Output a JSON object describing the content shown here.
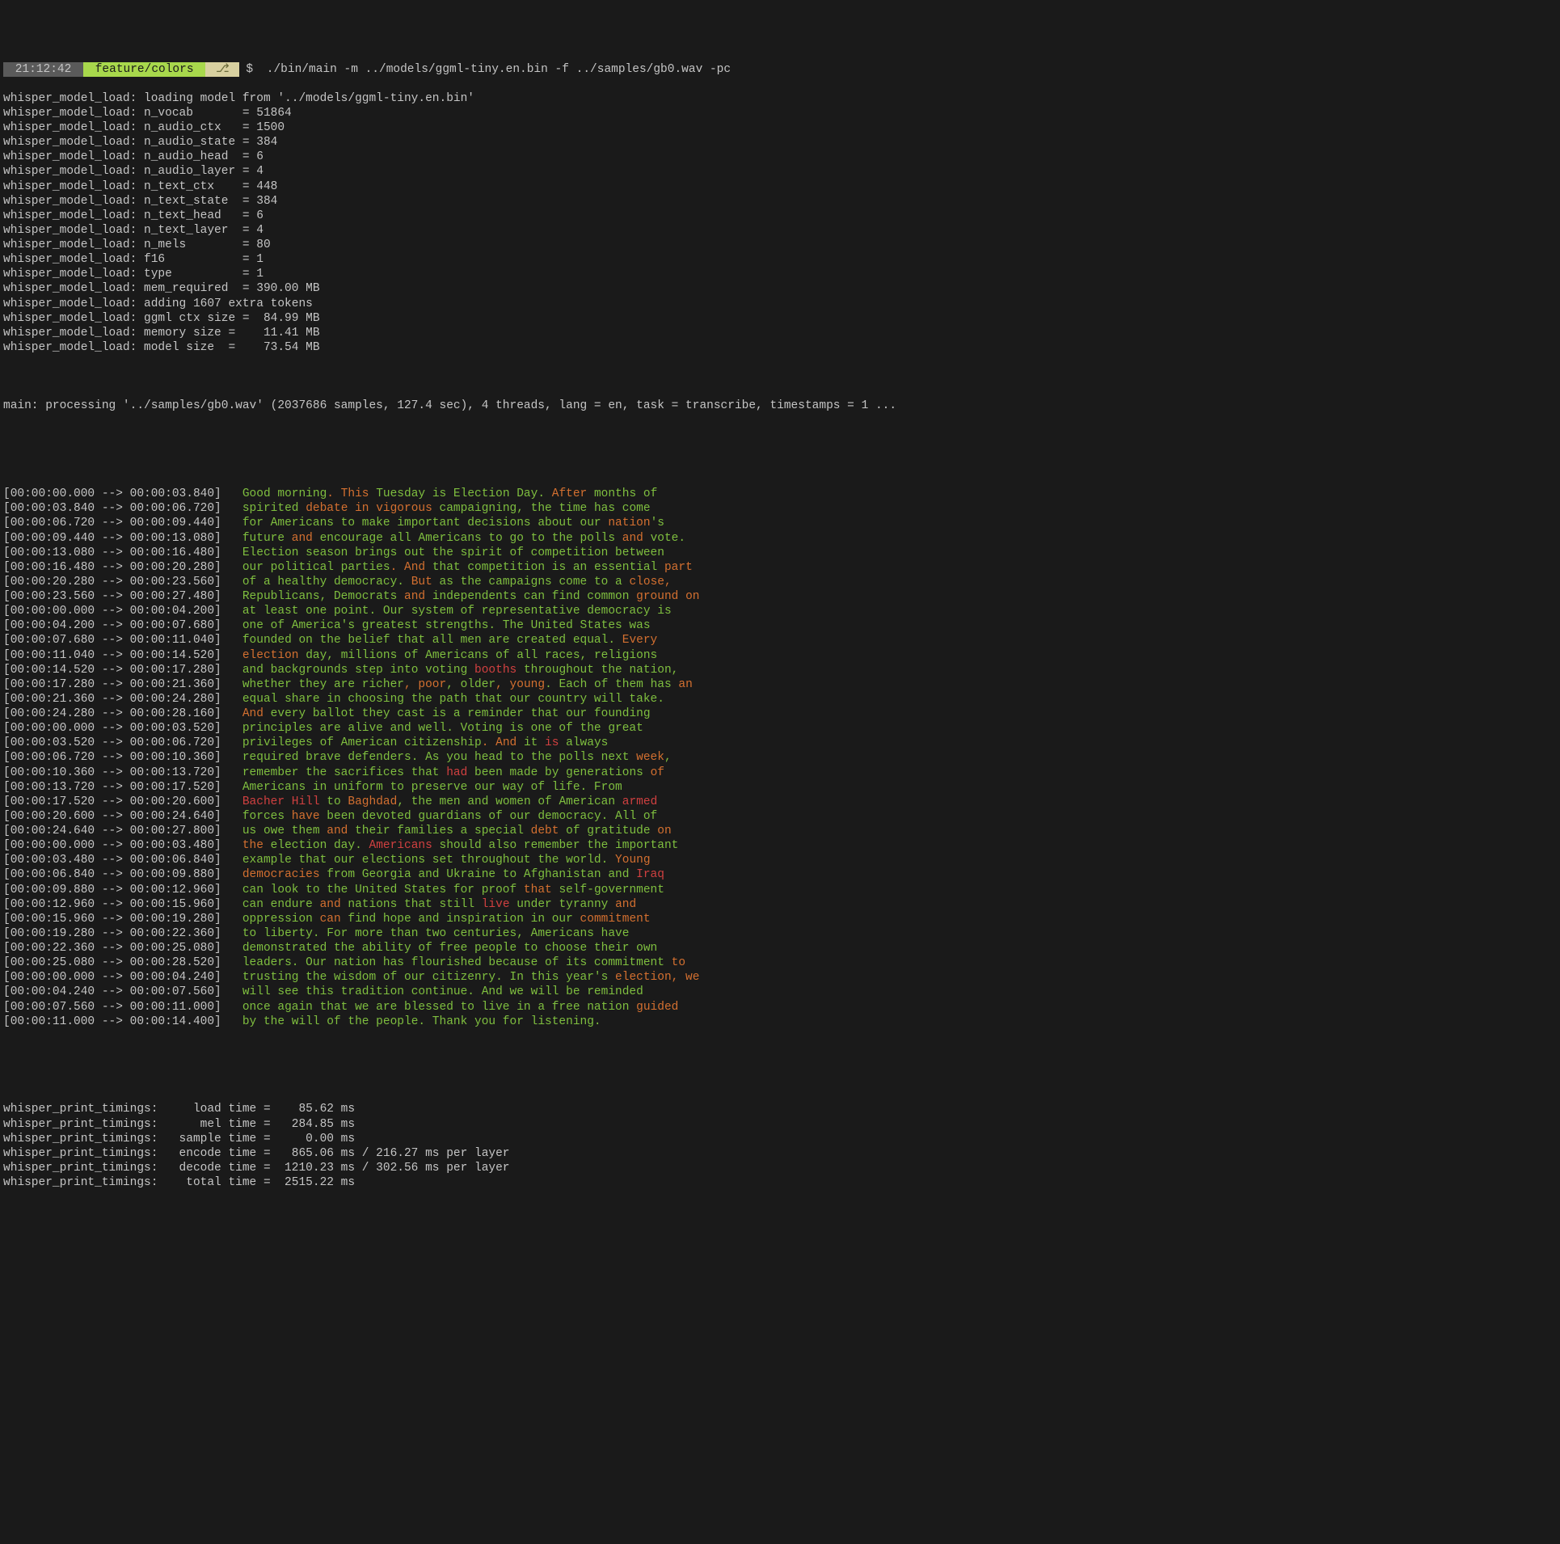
{
  "prompt": {
    "time": " 21:12:42 ",
    "branch": " feature/colors ",
    "branch_icon": " ⎇ ",
    "dollar": "$",
    "command": " ./bin/main -m ../models/ggml-tiny.en.bin -f ../samples/gb0.wav -pc"
  },
  "load_lines": [
    "whisper_model_load: loading model from '../models/ggml-tiny.en.bin'",
    "whisper_model_load: n_vocab       = 51864",
    "whisper_model_load: n_audio_ctx   = 1500",
    "whisper_model_load: n_audio_state = 384",
    "whisper_model_load: n_audio_head  = 6",
    "whisper_model_load: n_audio_layer = 4",
    "whisper_model_load: n_text_ctx    = 448",
    "whisper_model_load: n_text_state  = 384",
    "whisper_model_load: n_text_head   = 6",
    "whisper_model_load: n_text_layer  = 4",
    "whisper_model_load: n_mels        = 80",
    "whisper_model_load: f16           = 1",
    "whisper_model_load: type          = 1",
    "whisper_model_load: mem_required  = 390.00 MB",
    "whisper_model_load: adding 1607 extra tokens",
    "whisper_model_load: ggml ctx size =  84.99 MB",
    "whisper_model_load: memory size =    11.41 MB",
    "whisper_model_load: model size  =    73.54 MB"
  ],
  "main_line": "main: processing '../samples/gb0.wav' (2037686 samples, 127.4 sec), 4 threads, lang = en, task = transcribe, timestamps = 1 ...",
  "segments": [
    {
      "ts": "[00:00:00.000 --> 00:00:03.840]   ",
      "tok": [
        [
          "g",
          "Good morning"
        ],
        [
          "o",
          ". This "
        ],
        [
          "g",
          "Tuesday is Election Day. "
        ],
        [
          "o",
          "After "
        ],
        [
          "g",
          "months of"
        ]
      ]
    },
    {
      "ts": "[00:00:03.840 --> 00:00:06.720]   ",
      "tok": [
        [
          "g",
          "spirited "
        ],
        [
          "o",
          "debate in vigorous "
        ],
        [
          "g",
          "campaigning, the time has come"
        ]
      ]
    },
    {
      "ts": "[00:00:06.720 --> 00:00:09.440]   ",
      "tok": [
        [
          "g",
          "for Americans to make important decisions about our "
        ],
        [
          "o",
          "nation"
        ],
        [
          "g",
          "'s"
        ]
      ]
    },
    {
      "ts": "[00:00:09.440 --> 00:00:13.080]   ",
      "tok": [
        [
          "g",
          "future "
        ],
        [
          "o",
          "and "
        ],
        [
          "g",
          "encourage all Americans to go to the polls "
        ],
        [
          "o",
          "and "
        ],
        [
          "g",
          "vote."
        ]
      ]
    },
    {
      "ts": "[00:00:13.080 --> 00:00:16.480]   ",
      "tok": [
        [
          "g",
          "Election season brings out the spirit of competition between"
        ]
      ]
    },
    {
      "ts": "[00:00:16.480 --> 00:00:20.280]   ",
      "tok": [
        [
          "g",
          "our political parties"
        ],
        [
          "o",
          ". And "
        ],
        [
          "g",
          "that competition is an essential "
        ],
        [
          "o",
          "part"
        ]
      ]
    },
    {
      "ts": "[00:00:20.280 --> 00:00:23.560]   ",
      "tok": [
        [
          "g",
          "of a healthy democracy. "
        ],
        [
          "o",
          "But "
        ],
        [
          "g",
          "as the campaigns come to a "
        ],
        [
          "o",
          "close,"
        ]
      ]
    },
    {
      "ts": "[00:00:23.560 --> 00:00:27.480]   ",
      "tok": [
        [
          "g",
          "Republicans, Democrats "
        ],
        [
          "o",
          "and "
        ],
        [
          "g",
          "independents can find common "
        ],
        [
          "o",
          "ground on"
        ]
      ]
    },
    {
      "ts": "[00:00:00.000 --> 00:00:04.200]   ",
      "tok": [
        [
          "g",
          "at least one point. Our system of representative democracy is"
        ]
      ]
    },
    {
      "ts": "[00:00:04.200 --> 00:00:07.680]   ",
      "tok": [
        [
          "g",
          "one of America's greatest strengths. The United States was"
        ]
      ]
    },
    {
      "ts": "[00:00:07.680 --> 00:00:11.040]   ",
      "tok": [
        [
          "g",
          "founded on the belief that all men are created equal. "
        ],
        [
          "o",
          "Every"
        ]
      ]
    },
    {
      "ts": "[00:00:11.040 --> 00:00:14.520]   ",
      "tok": [
        [
          "o",
          "election "
        ],
        [
          "g",
          "day, millions of Americans of all races, religions"
        ]
      ]
    },
    {
      "ts": "[00:00:14.520 --> 00:00:17.280]   ",
      "tok": [
        [
          "g",
          "and backgrounds step into voting "
        ],
        [
          "r",
          "booths "
        ],
        [
          "g",
          "throughout the nation,"
        ]
      ]
    },
    {
      "ts": "[00:00:17.280 --> 00:00:21.360]   ",
      "tok": [
        [
          "g",
          "whether they are richer"
        ],
        [
          "o",
          ", poor"
        ],
        [
          "g",
          ", older"
        ],
        [
          "o",
          ", young"
        ],
        [
          "g",
          ". Each of them has "
        ],
        [
          "o",
          "an"
        ]
      ]
    },
    {
      "ts": "[00:00:21.360 --> 00:00:24.280]   ",
      "tok": [
        [
          "g",
          "equal share in choosing the path that our country will take."
        ]
      ]
    },
    {
      "ts": "[00:00:24.280 --> 00:00:28.160]   ",
      "tok": [
        [
          "o",
          "And "
        ],
        [
          "g",
          "every ballot they cast is a reminder that our founding"
        ]
      ]
    },
    {
      "ts": "[00:00:00.000 --> 00:00:03.520]   ",
      "tok": [
        [
          "g",
          "principles are alive and well. Voting is one of the great"
        ]
      ]
    },
    {
      "ts": "[00:00:03.520 --> 00:00:06.720]   ",
      "tok": [
        [
          "g",
          "privileges of American citizenship"
        ],
        [
          "o",
          ". And "
        ],
        [
          "g",
          "it "
        ],
        [
          "r",
          "is "
        ],
        [
          "g",
          "always"
        ]
      ]
    },
    {
      "ts": "[00:00:06.720 --> 00:00:10.360]   ",
      "tok": [
        [
          "g",
          "required brave defenders. As you head to the polls next "
        ],
        [
          "o",
          "week"
        ],
        [
          "g",
          ","
        ]
      ]
    },
    {
      "ts": "[00:00:10.360 --> 00:00:13.720]   ",
      "tok": [
        [
          "g",
          "remember the sacrifices that "
        ],
        [
          "r",
          "had "
        ],
        [
          "g",
          "been made by generations "
        ],
        [
          "o",
          "of"
        ]
      ]
    },
    {
      "ts": "[00:00:13.720 --> 00:00:17.520]   ",
      "tok": [
        [
          "g",
          "Americans in uniform to preserve our way of life. From"
        ]
      ]
    },
    {
      "ts": "[00:00:17.520 --> 00:00:20.600]   ",
      "tok": [
        [
          "r",
          "Bacher Hill "
        ],
        [
          "g",
          "to "
        ],
        [
          "o",
          "Baghdad"
        ],
        [
          "g",
          ", the men and women of American "
        ],
        [
          "r",
          "armed"
        ]
      ]
    },
    {
      "ts": "[00:00:20.600 --> 00:00:24.640]   ",
      "tok": [
        [
          "g",
          "forces "
        ],
        [
          "o",
          "have "
        ],
        [
          "g",
          "been devoted guardians of our democracy. All of"
        ]
      ]
    },
    {
      "ts": "[00:00:24.640 --> 00:00:27.800]   ",
      "tok": [
        [
          "g",
          "us owe them "
        ],
        [
          "o",
          "and "
        ],
        [
          "g",
          "their families a special "
        ],
        [
          "o",
          "debt "
        ],
        [
          "g",
          "of gratitude "
        ],
        [
          "o",
          "on"
        ]
      ]
    },
    {
      "ts": "[00:00:00.000 --> 00:00:03.480]   ",
      "tok": [
        [
          "o",
          "the "
        ],
        [
          "g",
          "election day. "
        ],
        [
          "r",
          "Americans "
        ],
        [
          "g",
          "should also remember the important"
        ]
      ]
    },
    {
      "ts": "[00:00:03.480 --> 00:00:06.840]   ",
      "tok": [
        [
          "g",
          "example that our elections set throughout the world. "
        ],
        [
          "o",
          "Young"
        ]
      ]
    },
    {
      "ts": "[00:00:06.840 --> 00:00:09.880]   ",
      "tok": [
        [
          "o",
          "democracies "
        ],
        [
          "g",
          "from Georgia and Ukraine to Afghanistan and "
        ],
        [
          "r",
          "Iraq"
        ]
      ]
    },
    {
      "ts": "[00:00:09.880 --> 00:00:12.960]   ",
      "tok": [
        [
          "g",
          "can look to the United States for proof "
        ],
        [
          "o",
          "that "
        ],
        [
          "g",
          "self-government"
        ]
      ]
    },
    {
      "ts": "[00:00:12.960 --> 00:00:15.960]   ",
      "tok": [
        [
          "g",
          "can endure "
        ],
        [
          "o",
          "and "
        ],
        [
          "g",
          "nations that still "
        ],
        [
          "r",
          "live "
        ],
        [
          "g",
          "under tyranny "
        ],
        [
          "o",
          "and"
        ]
      ]
    },
    {
      "ts": "[00:00:15.960 --> 00:00:19.280]   ",
      "tok": [
        [
          "g",
          "oppression "
        ],
        [
          "o",
          "can "
        ],
        [
          "g",
          "find hope and inspiration in our "
        ],
        [
          "o",
          "commitment"
        ]
      ]
    },
    {
      "ts": "[00:00:19.280 --> 00:00:22.360]   ",
      "tok": [
        [
          "g",
          "to liberty. For more than two centuries, Americans have"
        ]
      ]
    },
    {
      "ts": "[00:00:22.360 --> 00:00:25.080]   ",
      "tok": [
        [
          "g",
          "demonstrated the ability of free people to choose their own"
        ]
      ]
    },
    {
      "ts": "[00:00:25.080 --> 00:00:28.520]   ",
      "tok": [
        [
          "g",
          "leaders. Our nation has flourished because of its commitment "
        ],
        [
          "o",
          "to"
        ]
      ]
    },
    {
      "ts": "[00:00:00.000 --> 00:00:04.240]   ",
      "tok": [
        [
          "g",
          "trusting the wisdom of our citizenry. In this year's "
        ],
        [
          "o",
          "election, we"
        ]
      ]
    },
    {
      "ts": "[00:00:04.240 --> 00:00:07.560]   ",
      "tok": [
        [
          "g",
          "will see this tradition continue. And we will be reminded"
        ]
      ]
    },
    {
      "ts": "[00:00:07.560 --> 00:00:11.000]   ",
      "tok": [
        [
          "g",
          "once again that we are blessed to live in a free nation "
        ],
        [
          "o",
          "guided"
        ]
      ]
    },
    {
      "ts": "[00:00:11.000 --> 00:00:14.400]   ",
      "tok": [
        [
          "g",
          "by the will of the people. Thank you for listening."
        ]
      ]
    }
  ],
  "timings": [
    "whisper_print_timings:     load time =    85.62 ms",
    "whisper_print_timings:      mel time =   284.85 ms",
    "whisper_print_timings:   sample time =     0.00 ms",
    "whisper_print_timings:   encode time =   865.06 ms / 216.27 ms per layer",
    "whisper_print_timings:   decode time =  1210.23 ms / 302.56 ms per layer",
    "whisper_print_timings:    total time =  2515.22 ms"
  ]
}
